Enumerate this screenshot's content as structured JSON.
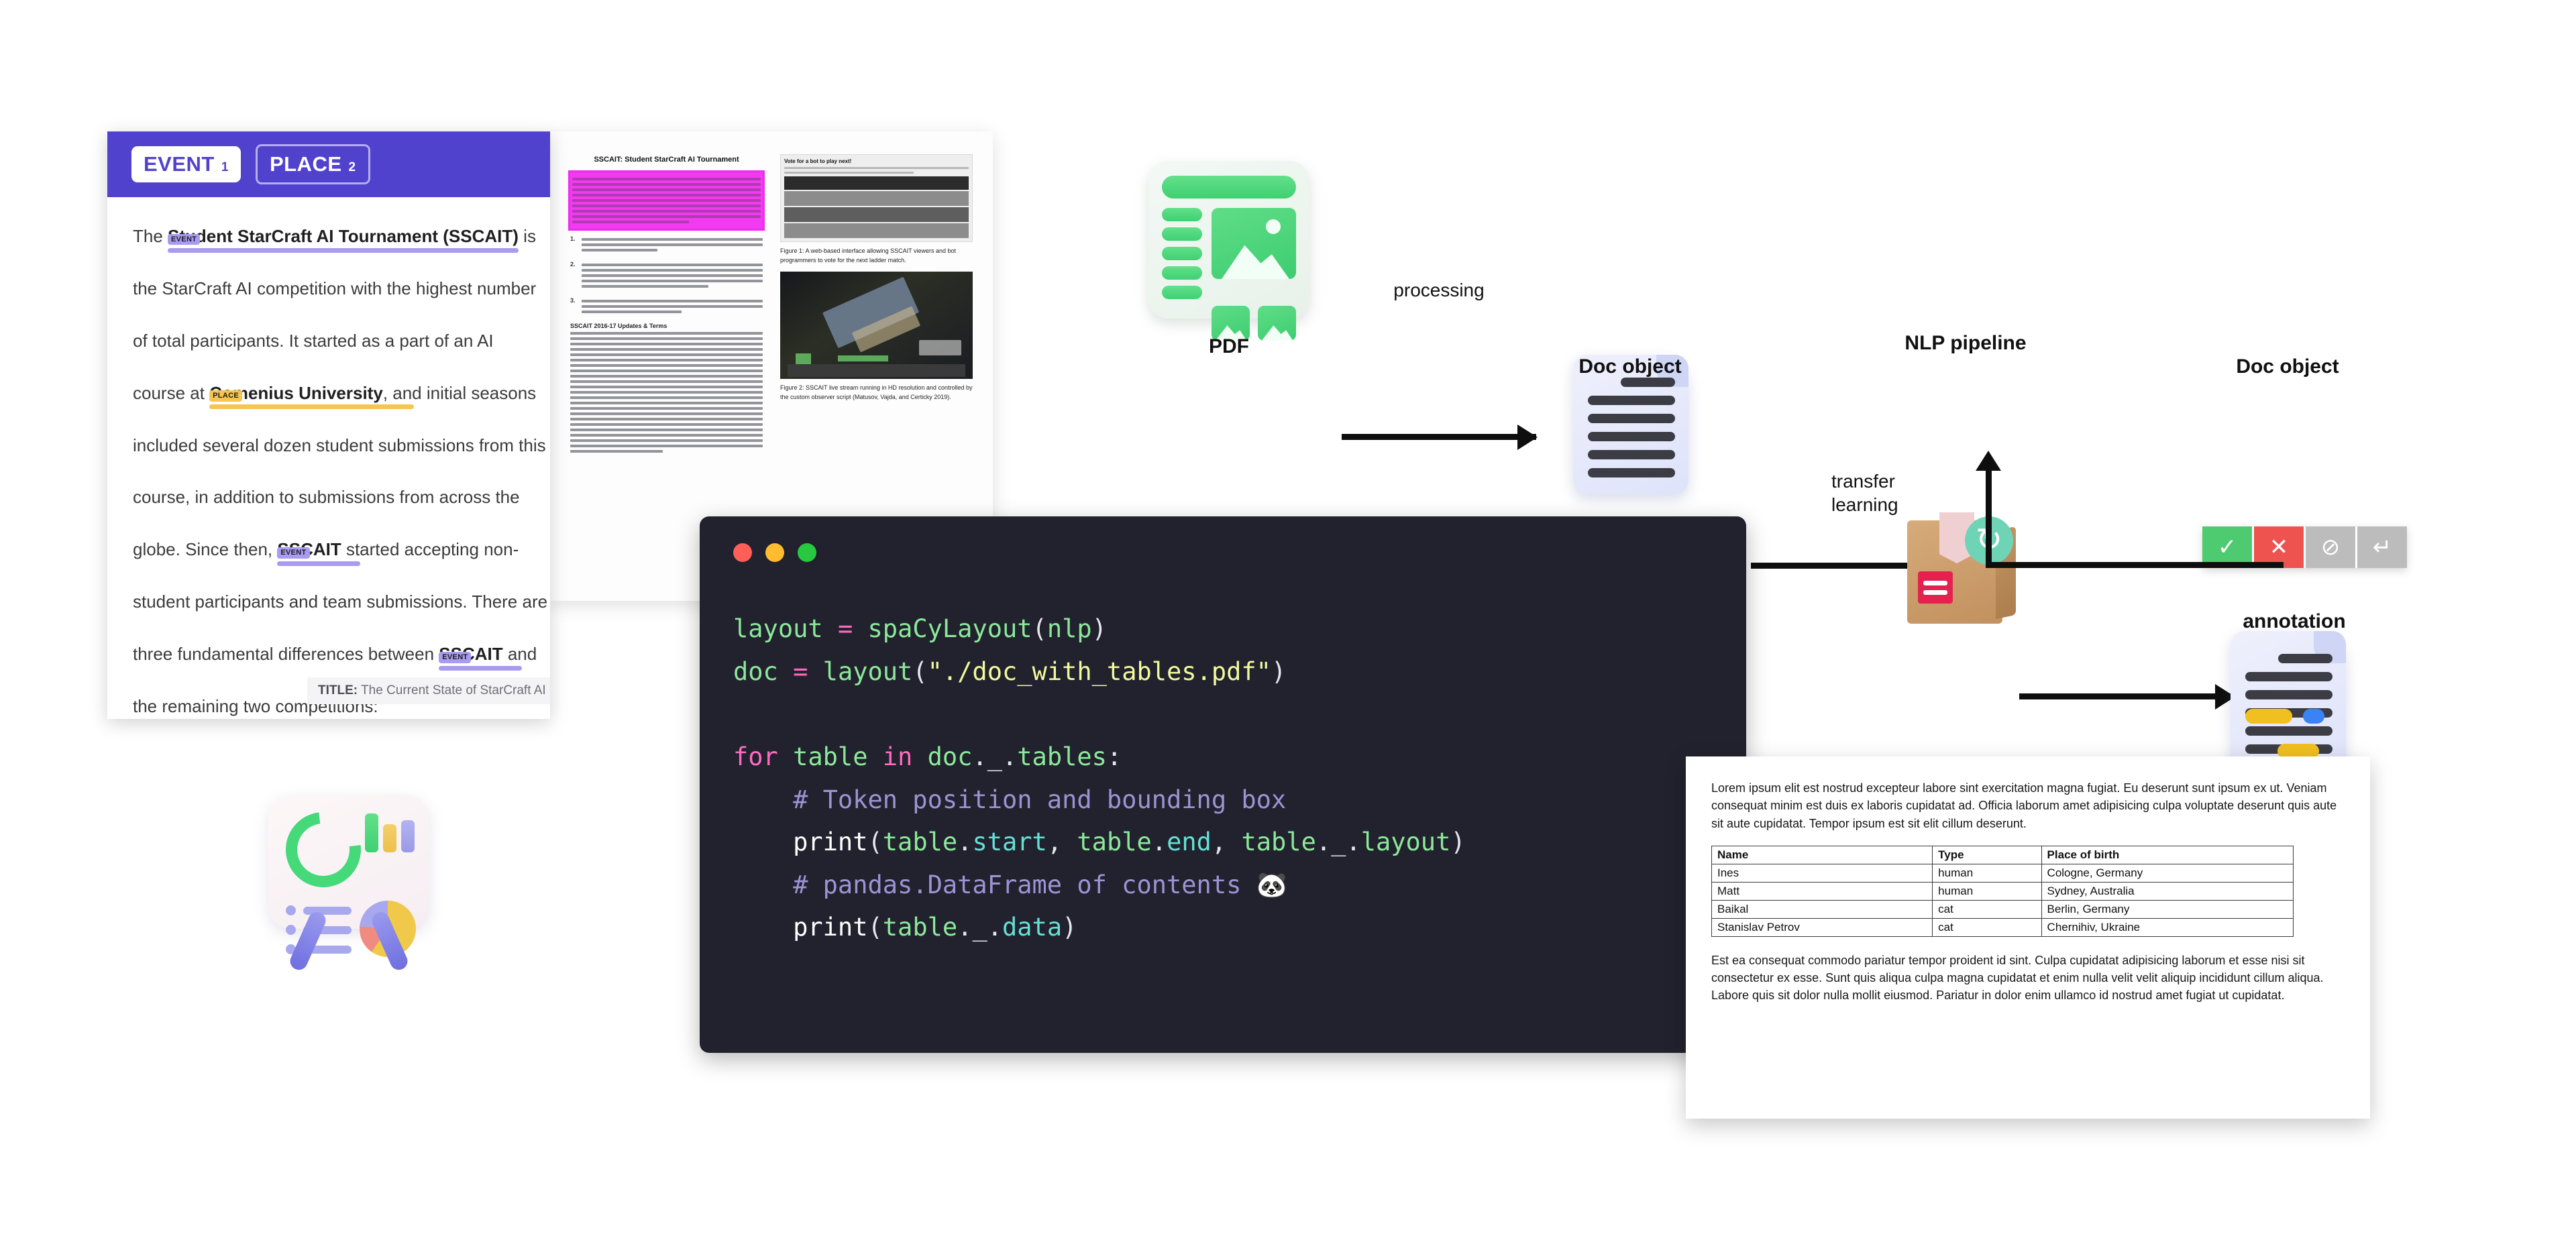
{
  "ner_panel": {
    "header": {
      "badges": [
        {
          "label": "EVENT",
          "count": "1",
          "style": "filled"
        },
        {
          "label": "PLACE",
          "count": "2",
          "style": "outline"
        }
      ],
      "bg_color": "#5142cd"
    },
    "lines": [
      {
        "pre": "The ",
        "ent": "Student StarCraft AI Tournament (SSCAIT)",
        "post": " is",
        "tag": "EVENT",
        "tag2": "EVENT"
      },
      {
        "pre": "the StarCraft AI competition with the highest number",
        "ent": "",
        "post": "",
        "tag": ""
      },
      {
        "pre": "of total participants. It started as a part of an AI",
        "ent": "",
        "post": "",
        "tag": ""
      },
      {
        "pre": "course at ",
        "ent": "Comenius University",
        "post": ", and initial seasons",
        "tag": "PLACE"
      },
      {
        "pre": "included several dozen student submissions from this",
        "ent": "",
        "post": "",
        "tag": ""
      },
      {
        "pre": "course, in addition to submissions from across the",
        "ent": "",
        "post": "",
        "tag": ""
      },
      {
        "pre": "globe. Since then, ",
        "ent": "SSCAIT",
        "post": " started accepting non-",
        "tag": "EVENT"
      },
      {
        "pre": "student participants and team submissions. There are",
        "ent": "",
        "post": "",
        "tag": ""
      },
      {
        "pre": "three fundamental differences between ",
        "ent": "SSCAIT",
        "post": " and",
        "tag": "EVENT"
      },
      {
        "pre": "the remaining two competitions:",
        "ent": "",
        "post": "",
        "tag": ""
      }
    ],
    "title_chip": {
      "label": "TITLE:",
      "value": "The Current State of StarCraft AI Competitions an"
    },
    "entity_colors": {
      "event": "#a89bf0",
      "place": "#f5c451"
    }
  },
  "paper_preview": {
    "title": "SSCAIT: Student StarCraft AI Tournament",
    "highlight_color": "#f13af1",
    "section_heading": "SSCAIT 2016-17 Updates & Terms",
    "numbered_items": [
      "1.",
      "2.",
      "3."
    ],
    "figure_ui_caption": "Vote for a bot to play next!",
    "figure1_caption": "Figure 1: A web-based interface allowing SSCAIT viewers and bot programmers to vote for the next ladder match.",
    "figure2_caption": "Figure 2: SSCAIT live stream running in HD resolution and controlled by the custom observer script (Matusov, Vajda, and Certicky 2019)."
  },
  "pipeline": {
    "nodes": [
      {
        "id": "pdf",
        "label": "PDF",
        "icon": "pdf-document-icon"
      },
      {
        "id": "doc1",
        "label": "Doc object",
        "icon": "doc-object-icon"
      },
      {
        "id": "nlp",
        "label": "NLP pipeline",
        "icon": "package-box-icon"
      },
      {
        "id": "doc2",
        "label": "Doc object",
        "icon": "doc-object-annotated-icon"
      }
    ],
    "arrows": [
      {
        "id": "processing",
        "label": "processing",
        "direction": "right"
      },
      {
        "id": "to-nlp",
        "label": "",
        "direction": "right"
      },
      {
        "id": "to-doc2",
        "label": "",
        "direction": "right"
      },
      {
        "id": "to-annotation",
        "label": "",
        "direction": "down"
      },
      {
        "id": "transfer",
        "label": "transfer\nlearning",
        "label_line1": "transfer",
        "label_line2": "learning",
        "direction": "up"
      }
    ],
    "annotation": {
      "label": "annotation",
      "buttons": [
        {
          "id": "accept",
          "glyph": "✓",
          "color": "#4ecb71",
          "name": "accept-button"
        },
        {
          "id": "reject",
          "glyph": "✕",
          "color": "#ef5350",
          "name": "reject-button"
        },
        {
          "id": "ignore",
          "glyph": "⊘",
          "color": "#bcbcbc",
          "name": "ignore-button"
        },
        {
          "id": "undo",
          "glyph": "↵",
          "color": "#bcbcbc",
          "name": "undo-button"
        }
      ]
    }
  },
  "code_window": {
    "traffic_lights": [
      "#ff5f57",
      "#febc2e",
      "#28c840"
    ],
    "language": "python",
    "background": "#22222e",
    "lines": [
      "layout = spaCyLayout(nlp)",
      "doc = layout(\"./doc_with_tables.pdf\")",
      "",
      "for table in doc._.tables:",
      "    # Token position and bounding box",
      "    print(table.start, table.end, table._.layout)",
      "    # pandas.DataFrame of contents 🐼",
      "    print(table._.data)"
    ]
  },
  "doc_card": {
    "paragraph_top": "Lorem ipsum elit est nostrud excepteur labore sint exercitation magna fugiat. Eu deserunt sunt ipsum ex ut. Veniam consequat minim est duis ex laboris cupidatat ad. Officia laborum amet adipisicing culpa voluptate deserunt quis aute sit aute cupidatat. Tempor ipsum est sit elit cillum deserunt.",
    "table": {
      "headers": [
        "Name",
        "Type",
        "Place of birth"
      ],
      "rows": [
        [
          "Ines",
          "human",
          "Cologne, Germany"
        ],
        [
          "Matt",
          "human",
          "Sydney, Australia"
        ],
        [
          "Baikal",
          "cat",
          "Berlin, Germany"
        ],
        [
          "Stanislav Petrov",
          "cat",
          "Chernihiv, Ukraine"
        ]
      ]
    },
    "paragraph_bottom": "Est ea consequat commodo pariatur tempor proident id sint. Culpa cupidatat adipisicing laborum et esse nisi sit consectetur ex esse. Sunt quis aliqua culpa magna cupidatat et enim nulla velit velit aliquip incididunt cillum aliqua. Labore quis sit dolor nulla mollit eiusmod. Pariatur in dolor enim ullamco id nostrud amet fugiat ut cupidatat."
  },
  "dashboard_icon": {
    "name": "analytics-dashboard-icon"
  }
}
